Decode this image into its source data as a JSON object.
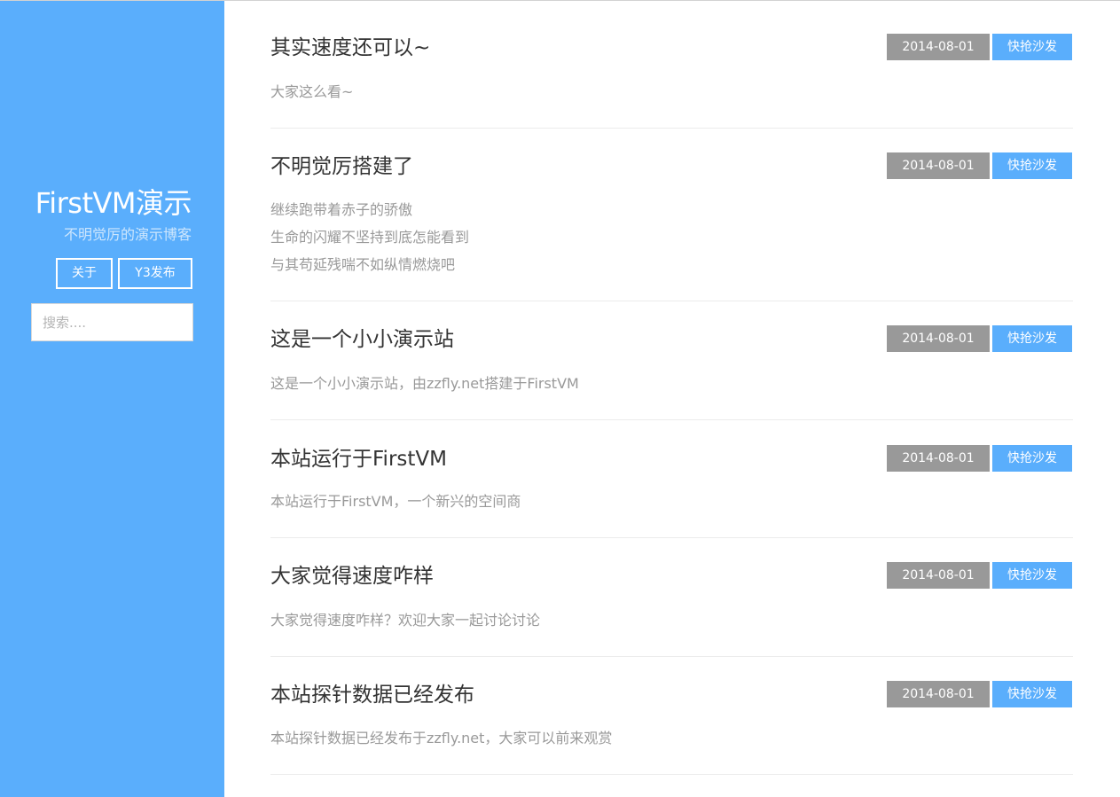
{
  "sidebar": {
    "title": "FirstVM演示",
    "subtitle": "不明觉厉的演示博客",
    "nav": [
      {
        "label": "关于"
      },
      {
        "label": "Y3发布"
      }
    ],
    "search_placeholder": "搜索...."
  },
  "posts": [
    {
      "title": "其实速度还可以~",
      "date": "2014-08-01",
      "comment_label": "快抢沙发",
      "excerpt_lines": [
        "大家这么看~"
      ]
    },
    {
      "title": "不明觉厉搭建了",
      "date": "2014-08-01",
      "comment_label": "快抢沙发",
      "excerpt_lines": [
        "继续跑带着赤子的骄傲",
        "生命的闪耀不坚持到底怎能看到",
        "与其苟延残喘不如纵情燃烧吧"
      ]
    },
    {
      "title": "这是一个小小演示站",
      "date": "2014-08-01",
      "comment_label": "快抢沙发",
      "excerpt_lines": [
        "这是一个小小演示站，由zzfly.net搭建于FirstVM"
      ]
    },
    {
      "title": "本站运行于FirstVM",
      "date": "2014-08-01",
      "comment_label": "快抢沙发",
      "excerpt_lines": [
        "本站运行于FirstVM，一个新兴的空间商"
      ]
    },
    {
      "title": "大家觉得速度咋样",
      "date": "2014-08-01",
      "comment_label": "快抢沙发",
      "excerpt_lines": [
        "大家觉得速度咋样？欢迎大家一起讨论讨论"
      ]
    },
    {
      "title": "本站探针数据已经发布",
      "date": "2014-08-01",
      "comment_label": "快抢沙发",
      "excerpt_lines": [
        "本站探针数据已经发布于zzfly.net，大家可以前来观赏"
      ]
    }
  ],
  "colors": {
    "accent": "#5aaefc",
    "date_badge": "#999999",
    "title_text": "#333333",
    "excerpt_text": "#999999"
  }
}
